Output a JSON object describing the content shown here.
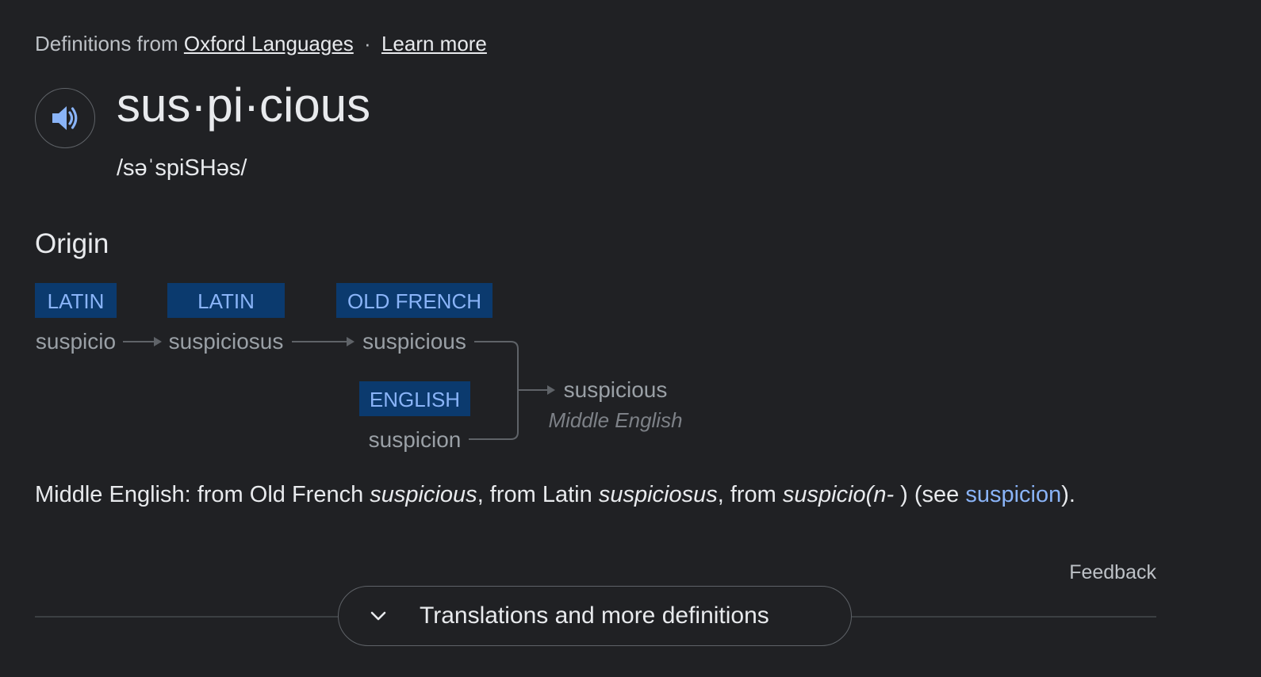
{
  "source": {
    "prefix": "Definitions from",
    "provider_link": "Oxford Languages",
    "separator": "·",
    "learn_more": "Learn more"
  },
  "entry": {
    "headword": "sus·pi·cious",
    "phonetic": "/səˈspiSHəs/",
    "speaker_icon": "volume-icon"
  },
  "origin": {
    "title": "Origin",
    "nodes": [
      {
        "lang": "LATIN",
        "word": "suspicio"
      },
      {
        "lang": "LATIN",
        "word": "suspiciosus"
      },
      {
        "lang": "OLD FRENCH",
        "word": "suspicious"
      },
      {
        "lang": "ENGLISH",
        "word": "suspicion"
      }
    ],
    "result": {
      "word": "suspicious",
      "lang": "Middle English"
    }
  },
  "etymology_note": {
    "t1": "Middle English: from Old French ",
    "w1": "suspicious",
    "t2": ", from Latin ",
    "w2": "suspiciosus",
    "t3": ", from ",
    "w3": "suspicio(n-",
    "t4": " ) (see ",
    "link": "suspicion",
    "t5": ")."
  },
  "feedback": "Feedback",
  "more_button": {
    "label": "Translations and more definitions",
    "icon": "chevron-down-icon"
  },
  "colors": {
    "background": "#202124",
    "accent": "#8ab4f8",
    "lang_box": "#0b3a6e"
  }
}
